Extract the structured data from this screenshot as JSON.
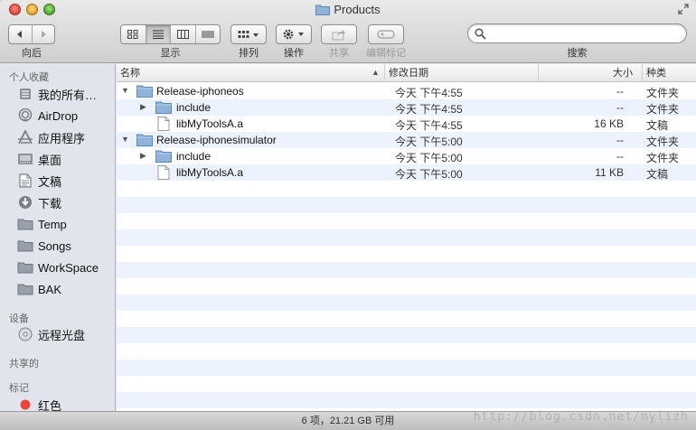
{
  "window": {
    "title": "Products"
  },
  "toolbar": {
    "back_label": "向后",
    "view_label": "显示",
    "arrange_label": "排列",
    "action_label": "操作",
    "share_label": "共享",
    "tags_label": "编辑标记",
    "search_label": "搜索",
    "search_value": ""
  },
  "sidebar": {
    "favorites_header": "个人收藏",
    "favorites": [
      {
        "label": "我的所有…",
        "icon": "all-files-icon"
      },
      {
        "label": "AirDrop",
        "icon": "airdrop-icon"
      },
      {
        "label": "应用程序",
        "icon": "applications-icon"
      },
      {
        "label": "桌面",
        "icon": "desktop-icon"
      },
      {
        "label": "文稿",
        "icon": "documents-icon"
      },
      {
        "label": "下载",
        "icon": "downloads-icon"
      },
      {
        "label": "Temp",
        "icon": "folder-icon"
      },
      {
        "label": "Songs",
        "icon": "folder-icon"
      },
      {
        "label": "WorkSpace",
        "icon": "folder-icon"
      },
      {
        "label": "BAK",
        "icon": "folder-icon"
      }
    ],
    "devices_header": "设备",
    "devices": [
      {
        "label": "远程光盘",
        "icon": "disc-icon"
      }
    ],
    "shared_header": "共享的",
    "tags_header": "标记",
    "tags": [
      {
        "label": "红色",
        "color": "#e8473f"
      }
    ]
  },
  "columns": {
    "name": "名称",
    "date": "修改日期",
    "size": "大小",
    "kind": "种类"
  },
  "files": [
    {
      "name": "Release-iphoneos",
      "date": "今天 下午4:55",
      "size": "--",
      "kind": "文件夹",
      "type": "folder",
      "level": 0,
      "expanded": true
    },
    {
      "name": "include",
      "date": "今天 下午4:55",
      "size": "--",
      "kind": "文件夹",
      "type": "folder",
      "level": 1,
      "expanded": false
    },
    {
      "name": "libMyToolsA.a",
      "date": "今天 下午4:55",
      "size": "16 KB",
      "kind": "文稿",
      "type": "file",
      "level": 1,
      "expanded": false
    },
    {
      "name": "Release-iphonesimulator",
      "date": "今天 下午5:00",
      "size": "--",
      "kind": "文件夹",
      "type": "folder",
      "level": 0,
      "expanded": true
    },
    {
      "name": "include",
      "date": "今天 下午5:00",
      "size": "--",
      "kind": "文件夹",
      "type": "folder",
      "level": 1,
      "expanded": false
    },
    {
      "name": "libMyToolsA.a",
      "date": "今天 下午5:00",
      "size": "11 KB",
      "kind": "文稿",
      "type": "file",
      "level": 1,
      "expanded": false
    }
  ],
  "status": {
    "text": "6 项，21.21 GB 可用"
  },
  "watermark": "http://blog.csdn.net/mylizh",
  "colors": {
    "folder": "#8fb3d9",
    "row_alt": "#edf3fe",
    "sidebar_bg": "#e1e4ea"
  }
}
